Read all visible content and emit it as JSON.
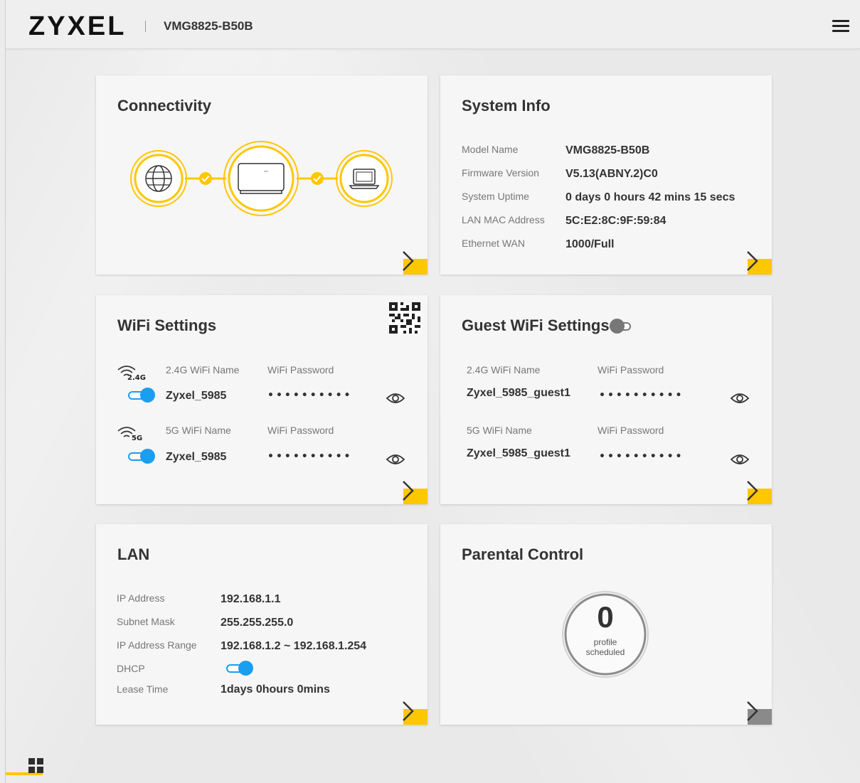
{
  "header": {
    "brand": "ZYXEL",
    "model": "VMG8825-B50B"
  },
  "icons": {
    "menu": "hamburger-menu-icon",
    "globe": "globe-icon",
    "router": "router-icon",
    "laptop": "laptop-icon",
    "check": "check-icon",
    "eye": "eye-icon",
    "qr": "qr-code-icon",
    "chevron": "chevron-right-icon",
    "grid": "grid-view-icon"
  },
  "colors": {
    "accent": "#ffc700",
    "toggle_on": "#1a9ef0",
    "toggle_off": "#777777"
  },
  "connectivity": {
    "title": "Connectivity"
  },
  "system_info": {
    "title": "System Info",
    "rows": [
      {
        "label": "Model Name",
        "value": "VMG8825-B50B"
      },
      {
        "label": "Firmware Version",
        "value": "V5.13(ABNY.2)C0"
      },
      {
        "label": "System Uptime",
        "value": "0 days 0 hours 42 mins 15 secs"
      },
      {
        "label": "LAN MAC Address",
        "value": "5C:E2:8C:9F:59:84"
      },
      {
        "label": "Ethernet WAN",
        "value": "1000/Full"
      }
    ]
  },
  "wifi": {
    "title": "WiFi Settings",
    "bands": [
      {
        "badge": "2.4G",
        "name_label": "2.4G WiFi Name",
        "password_label": "WiFi Password",
        "name": "Zyxel_5985",
        "password": "••••••••••",
        "enabled": true
      },
      {
        "badge": "5G",
        "name_label": "5G WiFi Name",
        "password_label": "WiFi Password",
        "name": "Zyxel_5985",
        "password": "••••••••••",
        "enabled": true
      }
    ]
  },
  "guest_wifi": {
    "title": "Guest WiFi Settings",
    "enabled": false,
    "bands": [
      {
        "name_label": "2.4G WiFi Name",
        "password_label": "WiFi Password",
        "name": "Zyxel_5985_guest1",
        "password": "••••••••••"
      },
      {
        "name_label": "5G WiFi Name",
        "password_label": "WiFi Password",
        "name": "Zyxel_5985_guest1",
        "password": "••••••••••"
      }
    ]
  },
  "lan": {
    "title": "LAN",
    "rows": [
      {
        "label": "IP Address",
        "value": "192.168.1.1"
      },
      {
        "label": "Subnet Mask",
        "value": "255.255.255.0"
      },
      {
        "label": "IP Address Range",
        "value": "192.168.1.2 ~ 192.168.1.254"
      },
      {
        "label": "DHCP",
        "value": ""
      },
      {
        "label": "Lease Time",
        "value": "1days 0hours 0mins"
      }
    ],
    "dhcp_enabled": true
  },
  "parental": {
    "title": "Parental Control",
    "count": "0",
    "line1": "profile",
    "line2": "scheduled"
  }
}
